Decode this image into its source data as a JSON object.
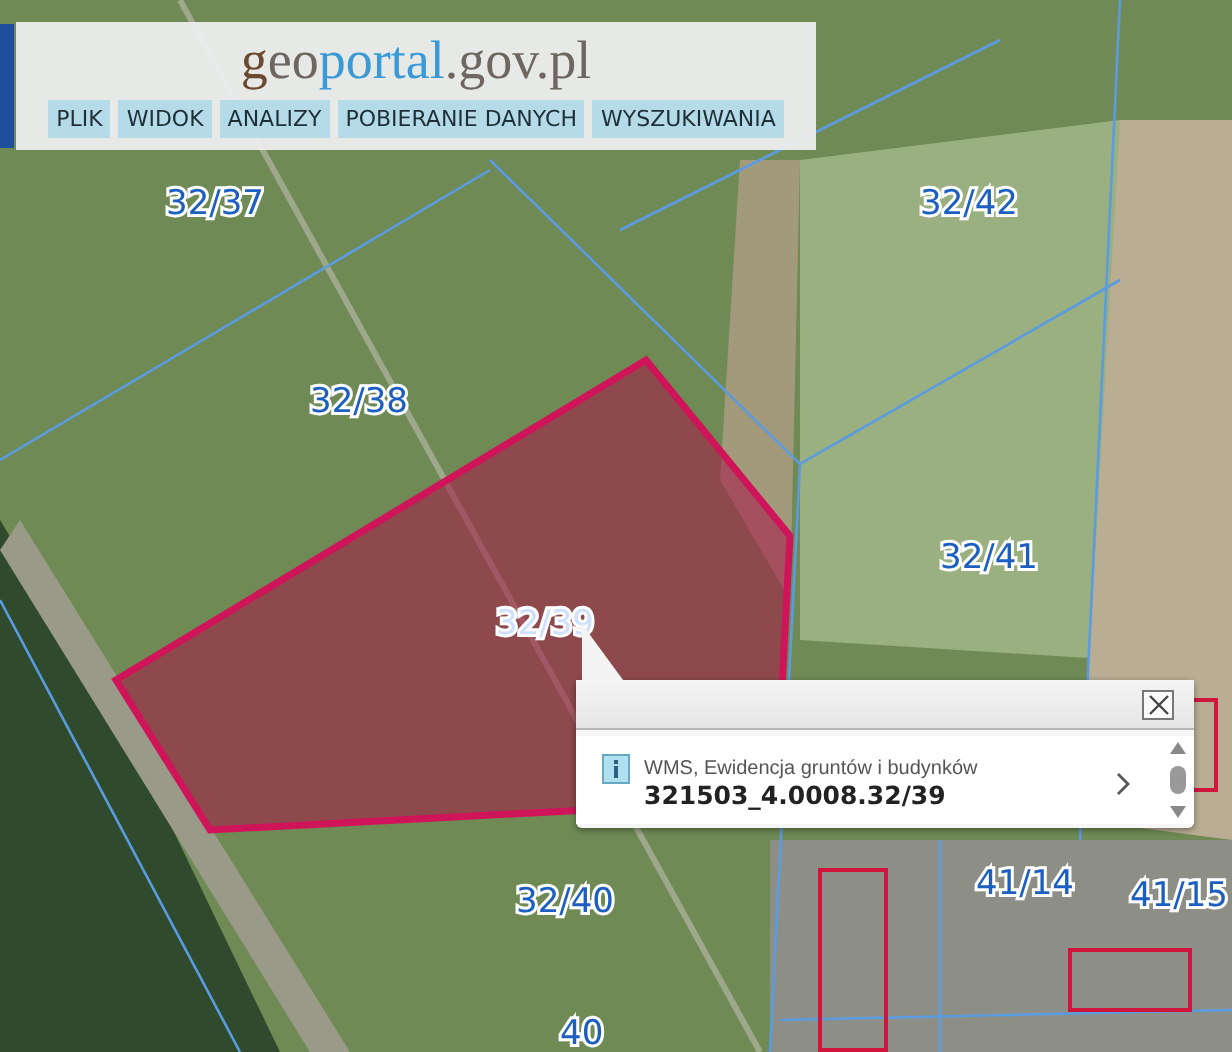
{
  "header": {
    "logo": [
      {
        "text": "g",
        "kind": "initial"
      },
      {
        "text": "eo",
        "kind": "plain"
      },
      {
        "text": "portal",
        "kind": "accent"
      },
      {
        "text": ".gov.pl",
        "kind": "plain"
      }
    ],
    "menu": [
      "PLIK",
      "WIDOK",
      "ANALIZY",
      "POBIERANIE DANYCH",
      "WYSZUKIWANIA"
    ]
  },
  "map": {
    "parcels": [
      {
        "label": "32/37",
        "selected": false
      },
      {
        "label": "32/38",
        "selected": false
      },
      {
        "label": "32/39",
        "selected": true
      },
      {
        "label": "32/40",
        "selected": false
      },
      {
        "label": "32/41",
        "selected": false
      },
      {
        "label": "32/42",
        "selected": false
      },
      {
        "label": "41/14",
        "selected": false
      },
      {
        "label": "41/15",
        "selected": false
      },
      {
        "label": "40",
        "selected": false
      }
    ]
  },
  "popup": {
    "layer": "WMS, Ewidencja gruntów i budynków",
    "identifier": "321503_4.0008.32/39"
  }
}
